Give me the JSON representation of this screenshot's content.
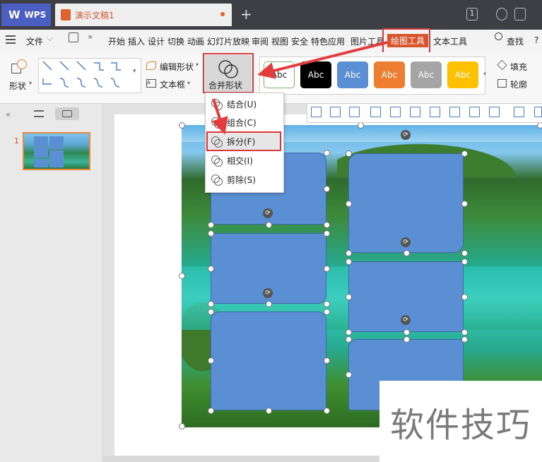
{
  "titlebar": {
    "app_name": "WPS",
    "doc_title": "演示文稿1",
    "add_tab": "+",
    "page_badge": "1"
  },
  "menu": {
    "file": "文件",
    "items": [
      "开始",
      "插入",
      "设计",
      "切换",
      "动画",
      "幻灯片放映",
      "审阅",
      "视图",
      "安全",
      "特色应用",
      "图片工具",
      "绘图工具",
      "文本工具"
    ],
    "search": "查找",
    "help": "?"
  },
  "ribbon": {
    "shape_label": "形状",
    "edit_shape": "编辑形状",
    "textbox": "文本框",
    "merge_shapes": "合并形状",
    "style_label": "Abc",
    "fill": "填充",
    "outline": "轮廓"
  },
  "style_colors": [
    "#ffffff",
    "#000000",
    "#5b8fd4",
    "#ed7d31",
    "#a5a5a5",
    "#ffc000"
  ],
  "merge_menu": [
    {
      "label": "结合(U)"
    },
    {
      "label": "组合(C)"
    },
    {
      "label": "拆分(F)"
    },
    {
      "label": "相交(I)"
    },
    {
      "label": "剪除(S)"
    }
  ],
  "slides_panel": {
    "slide_number": "1"
  },
  "watermark": "软件技巧",
  "accent": "#d73b3b"
}
